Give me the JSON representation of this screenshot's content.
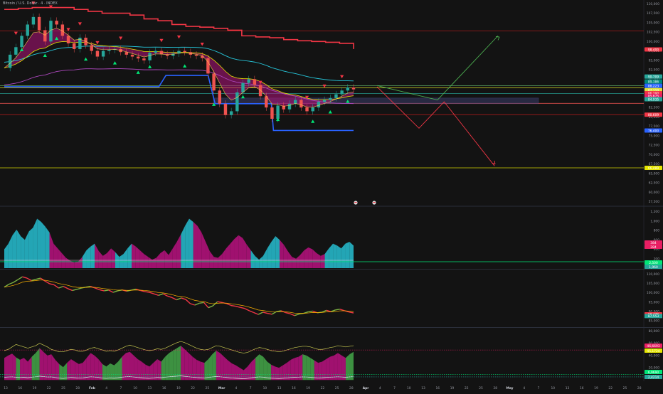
{
  "header": {
    "symbol_title": "Bitcoin / U.S. Dollar · 4 · INDEX"
  },
  "colors": {
    "background": "#131313",
    "price_up": "#26a69a",
    "price_down": "#ef5350",
    "accent_red": "#f23645",
    "accent_green": "#00e676",
    "cloud_magenta": "#b0127a",
    "cloud_cyan": "#26b6c8",
    "blue_line": "#2962ff",
    "yellow_line": "#e6e600",
    "projection_green": "#4caf50",
    "projection_red": "#f23645",
    "support_zone": "#3a3b6a"
  },
  "chart_data": [
    {
      "type": "line",
      "panel": "price",
      "y_ticks": [
        "110,000",
        "107,500",
        "105,000",
        "102,500",
        "100,000",
        "97,500",
        "95,000",
        "92,500",
        "90,000",
        "87,500",
        "85,000",
        "82,500",
        "80,000",
        "77,500",
        "75,000",
        "72,500",
        "70,000",
        "67,500",
        "65,000",
        "62,500",
        "60,000",
        "57,500"
      ],
      "ylim": [
        56500,
        111000
      ],
      "x_ticks": [
        "13",
        "16",
        "19",
        "22",
        "25",
        "28",
        "Feb",
        "4",
        "7",
        "10",
        "13",
        "16",
        "19",
        "22",
        "25",
        "Mar",
        "4",
        "7",
        "10",
        "13",
        "16",
        "19",
        "22",
        "25",
        "28",
        "Apr",
        "4",
        "7",
        "10",
        "13",
        "16",
        "19",
        "22",
        "25",
        "28",
        "May",
        "4",
        "7",
        "10",
        "13",
        "16",
        "19",
        "22",
        "25",
        "28"
      ],
      "price_series": [
        93000,
        96500,
        98500,
        101500,
        104500,
        106500,
        103000,
        100000,
        105500,
        104500,
        101500,
        99500,
        98000,
        101000,
        99000,
        97500,
        96000,
        97500,
        97800,
        98000,
        97200,
        96500,
        96000,
        95500,
        95000,
        97000,
        97500,
        96600,
        96200,
        96800,
        97500,
        97200,
        96500,
        96200,
        95600,
        91500,
        87000,
        83500,
        80500,
        81500,
        86500,
        89000,
        90000,
        88500,
        85500,
        82500,
        79500,
        83000,
        82000,
        83500,
        84500,
        82500,
        81500,
        82500,
        84000,
        84500,
        85000,
        86000,
        87000,
        87800,
        87300
      ],
      "resistance_series": [
        108500,
        108800,
        109000,
        109000,
        109000,
        108500,
        108000,
        107500,
        107500,
        107000,
        106000,
        105500,
        104500,
        104000,
        103800,
        103500,
        103000,
        101500,
        101200,
        101000,
        100500,
        100200,
        100000,
        99800,
        99500,
        98000
      ],
      "horizontal_levels": [
        {
          "price": 102800,
          "color": "#b71c1c"
        },
        {
          "price": 88300,
          "color": "#66bb6a"
        },
        {
          "price": 87700,
          "color": "#cfcf20"
        },
        {
          "price": 86200,
          "color": "#26a69a"
        },
        {
          "price": 83600,
          "color": "#ef5350"
        },
        {
          "price": 80600,
          "color": "#b71c1c"
        },
        {
          "price": 66500,
          "color": "#e6e600"
        }
      ],
      "support_zone": [
        83500,
        85000
      ],
      "projections": {
        "green": [
          [
            88300,
            0
          ],
          [
            84500,
            1
          ],
          [
            101500,
            2
          ]
        ],
        "red": [
          [
            88000,
            0
          ],
          [
            77000,
            1
          ],
          [
            84000,
            1.6
          ],
          [
            67000,
            2.8
          ]
        ]
      },
      "price_labels": [
        {
          "text": "98,400",
          "price": 97900,
          "color": "#f23645"
        },
        {
          "text": "90,709",
          "price": 90700,
          "color": "#26a69a"
        },
        {
          "text": "89,386",
          "price": 89400,
          "color": "#00897b"
        },
        {
          "text": "88,223",
          "price": 88250,
          "color": "#2962ff"
        },
        {
          "text": "87,110",
          "price": 87100,
          "color": "#e0e040"
        },
        {
          "text": "86,290",
          "price": 86300,
          "color": "#f23645"
        },
        {
          "text": "85,675",
          "price": 85600,
          "color": "#e91e63"
        },
        {
          "text": "84,935",
          "price": 84700,
          "color": "#26a69a"
        },
        {
          "text": "80,609",
          "price": 80600,
          "color": "#f23645"
        },
        {
          "text": "76,400",
          "price": 76400,
          "color": "#2962ff"
        },
        {
          "text": "66,489",
          "price": 66500,
          "color": "#e6e600"
        }
      ]
    },
    {
      "type": "area",
      "panel": "oscillator-1",
      "y_ticks": [
        "1,200",
        "1,000",
        "800",
        "600",
        "400",
        "200"
      ],
      "ylim": [
        0,
        1300
      ],
      "values": [
        400,
        520,
        700,
        820,
        680,
        600,
        780,
        860,
        1050,
        980,
        880,
        760,
        520,
        420,
        320,
        220,
        160,
        120,
        140,
        240,
        380,
        460,
        520,
        360,
        260,
        320,
        420,
        340,
        240,
        300,
        420,
        520,
        460,
        380,
        300,
        240,
        180,
        220,
        320,
        380,
        280,
        420,
        560,
        720,
        900,
        1050,
        980,
        900,
        760,
        560,
        360,
        240,
        220,
        300,
        420,
        520,
        620,
        700,
        640,
        500,
        380,
        260,
        180,
        260,
        420,
        560,
        680,
        600,
        500,
        360,
        240,
        200,
        280,
        380,
        440,
        400,
        320,
        260,
        300,
        420,
        520,
        480,
        420,
        520,
        560,
        480
      ],
      "sign_mask": "cccccccccccmmmmmmmmcccmmmmmccccmmmmmmmmmmmmcccmmmmmmmmmmmmmmcccccccmmmmmmmmmmmcccccccmmmcc",
      "value_labels": [
        {
          "text": "384",
          "value": 384,
          "color": "#e91e63"
        },
        {
          "text": "284",
          "value": 284,
          "color": "#e91e63"
        },
        {
          "text": "2,500",
          "value": -10,
          "color": "#00e676"
        },
        {
          "text": "1,960",
          "value": -110,
          "color": "#26a69a"
        }
      ]
    },
    {
      "type": "line",
      "panel": "oscillator-2",
      "y_ticks": [
        "110,000",
        "105,000",
        "100,000",
        "95,000",
        "90,000",
        "85,000"
      ],
      "ylim": [
        82000,
        112000
      ],
      "values": [
        103000,
        104500,
        105500,
        107000,
        108500,
        107800,
        106500,
        107200,
        107800,
        106200,
        104800,
        104200,
        102500,
        103400,
        102200,
        101200,
        101800,
        102500,
        103000,
        103400,
        102500,
        101600,
        101000,
        101400,
        100200,
        101000,
        101500,
        100800,
        101400,
        101900,
        101200,
        100600,
        100200,
        99400,
        98600,
        99400,
        98200,
        97400,
        96200,
        97200,
        96400,
        94200,
        93400,
        94400,
        94800,
        92000,
        93000,
        95200,
        94800,
        94200,
        93200,
        92800,
        92200,
        91600,
        90400,
        89400,
        88400,
        89600,
        89000,
        88500,
        89900,
        90400,
        89400,
        88800,
        87800,
        88600,
        89000,
        89800,
        90200,
        89300,
        89600,
        90600,
        89900,
        90800,
        91200,
        90400,
        89700,
        89200
      ],
      "value_labels": [
        {
          "text": "88,479",
          "value": 88479,
          "color": "#f23645"
        },
        {
          "text": "87,553",
          "value": 87553,
          "color": "#26a69a"
        }
      ]
    },
    {
      "type": "area",
      "panel": "oscillator-3",
      "y_ticks": [
        "80,000",
        "60,000",
        "40,000",
        "20,000"
      ],
      "ylim": [
        -2000,
        84000
      ],
      "values": [
        36000,
        40000,
        43000,
        37000,
        33000,
        36000,
        30000,
        38000,
        44000,
        52000,
        46000,
        40000,
        42000,
        33000,
        26000,
        21000,
        28000,
        34000,
        30000,
        26000,
        28000,
        36000,
        44000,
        40000,
        34000,
        26000,
        22000,
        27000,
        24000,
        30000,
        38000,
        44000,
        46000,
        40000,
        34000,
        30000,
        25000,
        22000,
        28000,
        34000,
        30000,
        38000,
        44000,
        48000,
        52000,
        56000,
        50000,
        44000,
        38000,
        33000,
        30000,
        28000,
        34000,
        42000,
        48000,
        44000,
        38000,
        32000,
        27000,
        24000,
        20000,
        16000,
        22000,
        30000,
        36000,
        42000,
        38000,
        30000,
        25000,
        22000,
        20000,
        24000,
        28000,
        33000,
        36000,
        38000,
        42000,
        40000,
        36000,
        32000,
        28000,
        30000,
        34000,
        38000,
        40000,
        44000,
        40000,
        36000,
        42000,
        46000
      ],
      "sign_mask": "mmmgmmmggmmmmmggmmmmmmmmmgggggmmmmmmmmmmgggggmmmmmmgggmmmmmmmmmmggggmmmmmmmmgggmmmmmmmmggmg",
      "signal": [
        48000,
        50000,
        54000,
        58000,
        56000,
        54000,
        52000,
        54000,
        56000,
        60000,
        57000,
        54000,
        50000,
        48000,
        46000,
        46000,
        48000,
        50000,
        49000,
        47000,
        47000,
        49000,
        52000,
        53000,
        51000,
        49000,
        47000,
        48000,
        47000,
        49000,
        52000,
        55000,
        57000,
        55000,
        53000,
        51000,
        49000,
        48000,
        49000,
        51000,
        50000,
        52000,
        55000,
        58000,
        61000,
        63000,
        61000,
        58000,
        55000,
        52000,
        50000,
        49000,
        50000,
        53000,
        56000,
        55000,
        53000,
        51000,
        49000,
        47000,
        45000,
        44000,
        45000,
        48000,
        51000,
        53000,
        52000,
        50000,
        48000,
        47000,
        46000,
        47000,
        49000,
        51000,
        53000,
        54000,
        55000,
        55000,
        54000,
        52000,
        50000,
        50000,
        51000,
        53000,
        54000,
        56000,
        55000,
        54000,
        55000,
        56000
      ],
      "value_labels": [
        {
          "text": "46,6693",
          "value": 46500,
          "color": "#e91e63"
        },
        {
          "text": "45,1724",
          "value": 44800,
          "color": "#e6e600"
        },
        {
          "text": "6,9690",
          "value": 8000,
          "color": "#00e676"
        },
        {
          "text": "2,4214",
          "value": 3800,
          "color": "#26a69a"
        }
      ]
    }
  ]
}
